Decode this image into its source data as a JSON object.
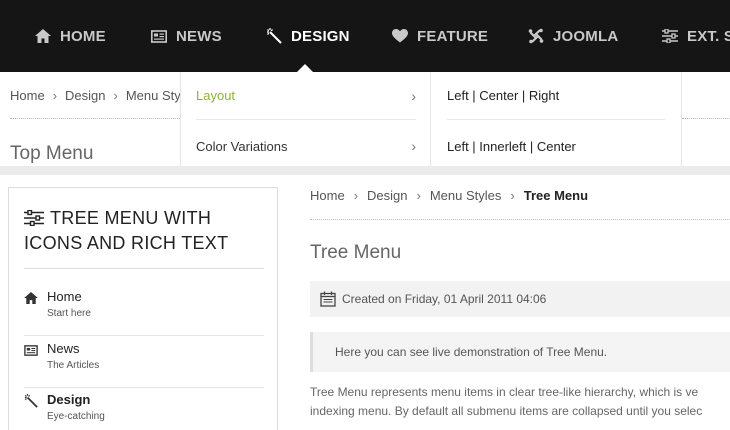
{
  "nav": {
    "items": [
      {
        "label": "HOME",
        "icon": "home-icon"
      },
      {
        "label": "NEWS",
        "icon": "newspaper-icon"
      },
      {
        "label": "DESIGN",
        "icon": "magic-wand-icon"
      },
      {
        "label": "FEATURE",
        "icon": "heart-icon"
      },
      {
        "label": "JOOMLA",
        "icon": "joomla-icon"
      },
      {
        "label": "EXT. ST",
        "icon": "sliders-icon"
      }
    ],
    "active": "DESIGN",
    "bg_color": "#151515",
    "accent_color": "#8cb339"
  },
  "upper": {
    "breadcrumb": [
      "Home",
      "Design",
      "Menu Styles"
    ],
    "title": "Top Menu"
  },
  "dropdown": {
    "col1": [
      "Layout",
      "Color Variations"
    ],
    "col2": [
      "Left | Center | Right",
      "Left | Innerleft | Center"
    ]
  },
  "sidebar": {
    "title": "TREE MENU WITH ICONS AND RICH TEXT",
    "items": [
      {
        "label": "Home",
        "sub": "Start here",
        "icon": "home-icon"
      },
      {
        "label": "News",
        "sub": "The Articles",
        "icon": "newspaper-icon"
      },
      {
        "label": "Design",
        "sub": "Eye-catching",
        "icon": "magic-wand-icon"
      }
    ]
  },
  "main": {
    "breadcrumb": [
      "Home",
      "Design",
      "Menu Styles"
    ],
    "breadcrumb_current": "Tree Menu",
    "title": "Tree Menu",
    "created": "Created on Friday, 01 April 2011 04:06",
    "intro": "Here you can see live demonstration of Tree Menu.",
    "body_line1": "Tree Menu represents menu items in clear tree-like hierarchy, which is ve",
    "body_line2": "indexing menu. By default all submenu items are collapsed until you selec"
  }
}
